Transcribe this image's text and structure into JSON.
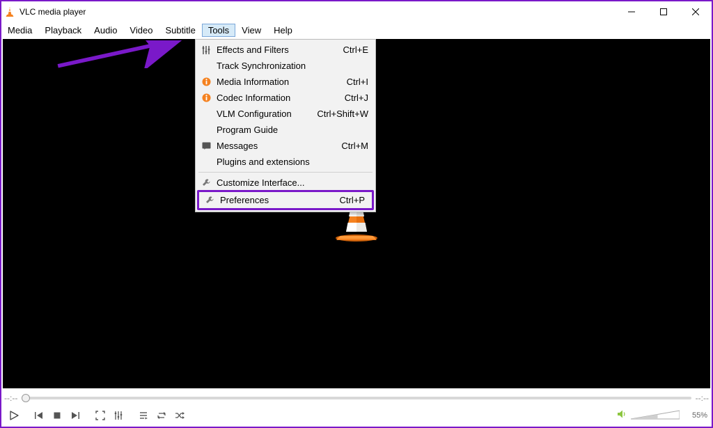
{
  "title": "VLC media player",
  "menubar": [
    "Media",
    "Playback",
    "Audio",
    "Video",
    "Subtitle",
    "Tools",
    "View",
    "Help"
  ],
  "open_menu_index": 5,
  "tools_menu": {
    "items": [
      {
        "icon": "sliders",
        "label": "Effects and Filters",
        "shortcut": "Ctrl+E"
      },
      {
        "icon": "",
        "label": "Track Synchronization",
        "shortcut": ""
      },
      {
        "icon": "info",
        "label": "Media Information",
        "shortcut": "Ctrl+I"
      },
      {
        "icon": "info",
        "label": "Codec Information",
        "shortcut": "Ctrl+J"
      },
      {
        "icon": "",
        "label": "VLM Configuration",
        "shortcut": "Ctrl+Shift+W"
      },
      {
        "icon": "",
        "label": "Program Guide",
        "shortcut": ""
      },
      {
        "icon": "msg",
        "label": "Messages",
        "shortcut": "Ctrl+M"
      },
      {
        "icon": "",
        "label": "Plugins and extensions",
        "shortcut": ""
      }
    ],
    "items2": [
      {
        "icon": "wrench",
        "label": "Customize Interface...",
        "shortcut": ""
      }
    ],
    "highlighted": {
      "icon": "wrench",
      "label": "Preferences",
      "shortcut": "Ctrl+P"
    }
  },
  "seek": {
    "left": "--:--",
    "right": "--:--"
  },
  "volume": {
    "percent": "55%"
  },
  "annotation_color": "#7a19c9"
}
